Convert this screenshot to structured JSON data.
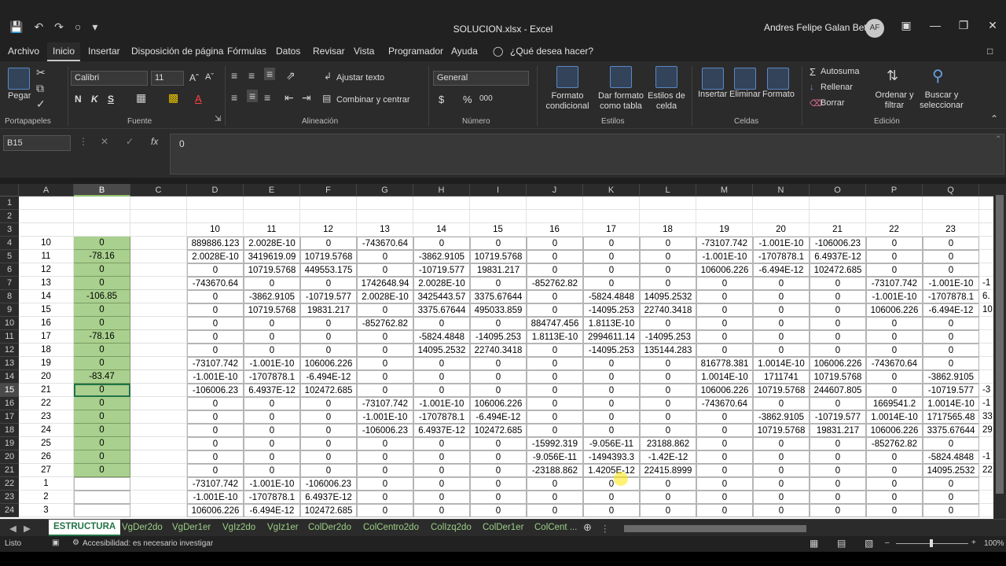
{
  "window": {
    "title": "SOLUCION.xlsx  -  Excel",
    "user": "Andres Felipe Galan Bettin",
    "avatar": "AF"
  },
  "menu": [
    "Archivo",
    "Inicio",
    "Insertar",
    "Disposición de página",
    "Fórmulas",
    "Datos",
    "Revisar",
    "Vista",
    "Programador",
    "Ayuda",
    "¿Qué desea hacer?"
  ],
  "ribbon": {
    "portapapeles": {
      "paste": "Pegar",
      "label": "Portapapeles"
    },
    "fuente": {
      "font": "Calibri",
      "size": "11",
      "label": "Fuente",
      "bold": "N",
      "italic": "K",
      "underline": "S"
    },
    "alineacion": {
      "wrap": "Ajustar texto",
      "merge": "Combinar y centrar",
      "label": "Alineación"
    },
    "numero": {
      "format": "General",
      "currency": "$",
      "percent": "%",
      "thousands": "000",
      "label": "Número"
    },
    "estilos": {
      "cond": "Formato condicional",
      "table": "Dar formato como tabla",
      "cell": "Estilos de celda",
      "label": "Estilos"
    },
    "celdas": {
      "insert": "Insertar",
      "delete": "Eliminar",
      "format": "Formato",
      "label": "Celdas"
    },
    "edicion": {
      "autosum": "Autosuma",
      "fill": "Rellenar",
      "clear": "Borrar",
      "sort": "Ordenar y filtrar",
      "find": "Buscar y seleccionar",
      "label": "Edición"
    }
  },
  "formula_bar": {
    "name_box": "B15",
    "fx": "fx",
    "value": "0"
  },
  "columns": [
    "A",
    "B",
    "C",
    "D",
    "E",
    "F",
    "G",
    "H",
    "I",
    "J",
    "K",
    "L",
    "M",
    "N",
    "O",
    "P",
    "Q"
  ],
  "rows": [
    {
      "n": "1",
      "a": "",
      "b": "",
      "v": []
    },
    {
      "n": "2",
      "a": "",
      "b": "",
      "v": []
    },
    {
      "n": "3",
      "a": "",
      "b": "",
      "v": [
        "10",
        "11",
        "12",
        "13",
        "14",
        "15",
        "16",
        "17",
        "18",
        "19",
        "20",
        "21",
        "22",
        "23"
      ]
    },
    {
      "n": "4",
      "a": "10",
      "b": "0",
      "v": [
        "889886.123",
        "2.0028E-10",
        "0",
        "-743670.64",
        "0",
        "0",
        "0",
        "0",
        "0",
        "-73107.742",
        "-1.001E-10",
        "-106006.23",
        "0",
        "0"
      ]
    },
    {
      "n": "5",
      "a": "11",
      "b": "-78.16",
      "v": [
        "2.0028E-10",
        "3419619.09",
        "10719.5768",
        "0",
        "-3862.9105",
        "10719.5768",
        "0",
        "0",
        "0",
        "-1.001E-10",
        "-1707878.1",
        "6.4937E-12",
        "0",
        "0"
      ]
    },
    {
      "n": "6",
      "a": "12",
      "b": "0",
      "v": [
        "0",
        "10719.5768",
        "449553.175",
        "0",
        "-10719.577",
        "19831.217",
        "0",
        "0",
        "0",
        "106006.226",
        "-6.494E-12",
        "102472.685",
        "0",
        "0"
      ]
    },
    {
      "n": "7",
      "a": "13",
      "b": "0",
      "v": [
        "-743670.64",
        "0",
        "0",
        "1742648.94",
        "2.0028E-10",
        "0",
        "-852762.82",
        "0",
        "0",
        "0",
        "0",
        "0",
        "-73107.742",
        "-1.001E-10"
      ]
    },
    {
      "n": "8",
      "a": "14",
      "b": "-106.85",
      "v": [
        "0",
        "-3862.9105",
        "-10719.577",
        "2.0028E-10",
        "3425443.57",
        "3375.67644",
        "0",
        "-5824.4848",
        "14095.2532",
        "0",
        "0",
        "0",
        "-1.001E-10",
        "-1707878.1"
      ]
    },
    {
      "n": "9",
      "a": "15",
      "b": "0",
      "v": [
        "0",
        "10719.5768",
        "19831.217",
        "0",
        "3375.67644",
        "495033.859",
        "0",
        "-14095.253",
        "22740.3418",
        "0",
        "0",
        "0",
        "106006.226",
        "-6.494E-12"
      ]
    },
    {
      "n": "10",
      "a": "16",
      "b": "0",
      "v": [
        "0",
        "0",
        "0",
        "-852762.82",
        "0",
        "0",
        "884747.456",
        "1.8113E-10",
        "0",
        "0",
        "0",
        "0",
        "0",
        "0"
      ]
    },
    {
      "n": "11",
      "a": "17",
      "b": "-78.16",
      "v": [
        "0",
        "0",
        "0",
        "0",
        "-5824.4848",
        "-14095.253",
        "1.8113E-10",
        "2994611.14",
        "-14095.253",
        "0",
        "0",
        "0",
        "0",
        "0"
      ]
    },
    {
      "n": "12",
      "a": "18",
      "b": "0",
      "v": [
        "0",
        "0",
        "0",
        "0",
        "14095.2532",
        "22740.3418",
        "0",
        "-14095.253",
        "135144.283",
        "0",
        "0",
        "0",
        "0",
        "0"
      ]
    },
    {
      "n": "13",
      "a": "19",
      "b": "0",
      "v": [
        "-73107.742",
        "-1.001E-10",
        "106006.226",
        "0",
        "0",
        "0",
        "0",
        "0",
        "0",
        "816778.381",
        "1.0014E-10",
        "106006.226",
        "-743670.64",
        "0"
      ]
    },
    {
      "n": "14",
      "a": "20",
      "b": "-83.47",
      "v": [
        "-1.001E-10",
        "-1707878.1",
        "-6.494E-12",
        "0",
        "0",
        "0",
        "0",
        "0",
        "0",
        "1.0014E-10",
        "1711741",
        "10719.5768",
        "0",
        "-3862.9105"
      ]
    },
    {
      "n": "15",
      "a": "21",
      "b": "0",
      "v": [
        "-106006.23",
        "6.4937E-12",
        "102472.685",
        "0",
        "0",
        "0",
        "0",
        "0",
        "0",
        "106006.226",
        "10719.5768",
        "244607.805",
        "0",
        "-10719.577"
      ]
    },
    {
      "n": "16",
      "a": "22",
      "b": "0",
      "v": [
        "0",
        "0",
        "0",
        "-73107.742",
        "-1.001E-10",
        "106006.226",
        "0",
        "0",
        "0",
        "-743670.64",
        "0",
        "0",
        "1669541.2",
        "1.0014E-10"
      ]
    },
    {
      "n": "17",
      "a": "23",
      "b": "0",
      "v": [
        "0",
        "0",
        "0",
        "-1.001E-10",
        "-1707878.1",
        "-6.494E-12",
        "0",
        "0",
        "0",
        "0",
        "-3862.9105",
        "-10719.577",
        "1.0014E-10",
        "1717565.48"
      ]
    },
    {
      "n": "18",
      "a": "24",
      "b": "0",
      "v": [
        "0",
        "0",
        "0",
        "-106006.23",
        "6.4937E-12",
        "102472.685",
        "0",
        "0",
        "0",
        "0",
        "10719.5768",
        "19831.217",
        "106006.226",
        "3375.67644"
      ]
    },
    {
      "n": "19",
      "a": "25",
      "b": "0",
      "v": [
        "0",
        "0",
        "0",
        "0",
        "0",
        "0",
        "-15992.319",
        "-9.056E-11",
        "23188.862",
        "0",
        "0",
        "0",
        "-852762.82",
        "0"
      ]
    },
    {
      "n": "20",
      "a": "26",
      "b": "0",
      "v": [
        "0",
        "0",
        "0",
        "0",
        "0",
        "0",
        "-9.056E-11",
        "-1494393.3",
        "-1.42E-12",
        "0",
        "0",
        "0",
        "0",
        "-5824.4848"
      ]
    },
    {
      "n": "21",
      "a": "27",
      "b": "0",
      "v": [
        "0",
        "0",
        "0",
        "0",
        "0",
        "0",
        "-23188.862",
        "1.4205E-12",
        "22415.8999",
        "0",
        "0",
        "0",
        "0",
        "14095.2532"
      ]
    },
    {
      "n": "22",
      "a": "1",
      "b": "",
      "v": [
        "-73107.742",
        "-1.001E-10",
        "-106006.23",
        "0",
        "0",
        "0",
        "0",
        "0",
        "0",
        "0",
        "0",
        "0",
        "0",
        "0"
      ]
    },
    {
      "n": "23",
      "a": "2",
      "b": "",
      "v": [
        "-1.001E-10",
        "-1707878.1",
        "6.4937E-12",
        "0",
        "0",
        "0",
        "0",
        "0",
        "0",
        "0",
        "0",
        "0",
        "0",
        "0"
      ]
    },
    {
      "n": "24",
      "a": "3",
      "b": "",
      "v": [
        "106006.226",
        "-6.494E-12",
        "102472.685",
        "0",
        "0",
        "0",
        "0",
        "0",
        "0",
        "0",
        "0",
        "0",
        "0",
        "0"
      ]
    }
  ],
  "overflow_r": [
    "",
    "",
    "",
    "",
    "",
    "",
    "-1",
    "6.",
    "10",
    "",
    "",
    "",
    "",
    "",
    "-3",
    "-1",
    "33",
    "29",
    "",
    "-1",
    "22",
    "",
    "",
    ""
  ],
  "sheets": [
    "ESTRUCTURA",
    "VgDer2do",
    "VgDer1er",
    "VgIz2do",
    "VgIz1er",
    "ColDer2do",
    "ColCentro2do",
    "ColIzq2do",
    "ColDer1er",
    "ColCent ..."
  ],
  "status": {
    "ready": "Listo",
    "accessibility": "Accesibilidad: es necesario investigar",
    "zoom": "100%"
  }
}
